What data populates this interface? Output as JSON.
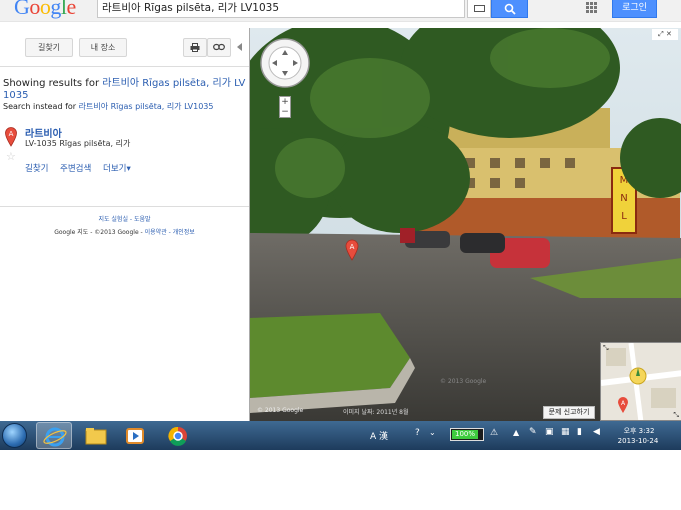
{
  "topbar": {
    "logo": "Google",
    "search_value": "라트비아 Rīgas pilsēta, 리가 LV1035",
    "login_label": "로그인"
  },
  "panel": {
    "directions_label": "길찾기",
    "my_places_label": "내 장소",
    "showing_prefix": "Showing results for",
    "showing_query": "라트비아 Rīgas pilsēta, 리가 LV 1035",
    "instead_prefix": "Search instead for",
    "instead_query": "라트비아 Rīgas pilsēta, 리가 LV1035",
    "result": {
      "pin_letter": "A",
      "title": "라트비아",
      "address": "LV-1035 Rīgas pilsēta, 리가",
      "links": [
        "길찾기",
        "주변검색",
        "더보기▾"
      ]
    },
    "footer_links": "지도 실험실 - 도움말",
    "footer_copy_prefix": "Google 지도 - ©2013 Google -",
    "footer_copy_links": "이용약관 - 개인정보"
  },
  "map": {
    "marker_letter": "A",
    "copyright": "© 2013 Google",
    "capture": "이미지 날짜: 2011년 8월",
    "watermark": "© 2013 Google",
    "report_label": "문제 신고하기",
    "mini_marker": "A",
    "sign_letters": [
      "M",
      "N",
      "L"
    ]
  },
  "taskbar": {
    "battery": "100%",
    "time": "오후 3:32",
    "date": "2013-10-24",
    "ime": "A 漢"
  },
  "colors": {
    "accent": "#4d90fe",
    "link": "#2a5db0",
    "marker": "#e74c3c"
  }
}
